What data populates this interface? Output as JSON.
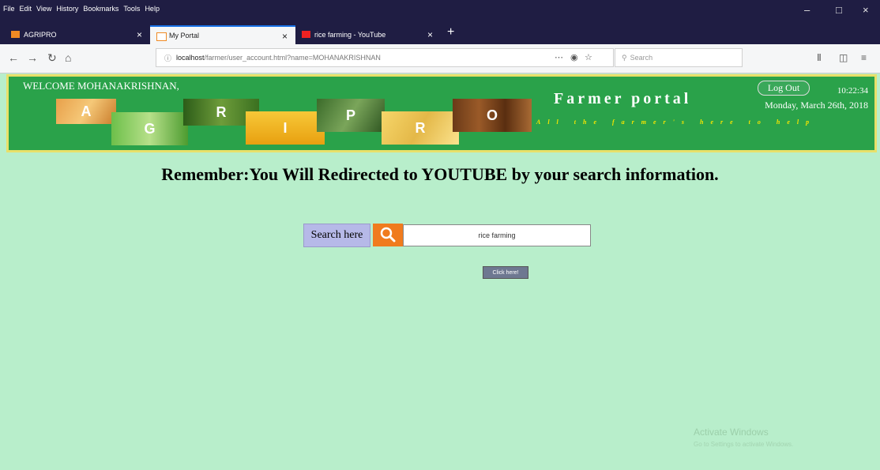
{
  "menubar": {
    "items": [
      "File",
      "Edit",
      "View",
      "History",
      "Bookmarks",
      "Tools",
      "Help"
    ]
  },
  "tabs": [
    {
      "label": "AGRIPRO"
    },
    {
      "label": "My Portal"
    },
    {
      "label": "rice farming - YouTube"
    }
  ],
  "navbar": {
    "url_host": "localhost",
    "url_rest": "/farmer/user_account.html?name=MOHANAKRISHNAN",
    "search_placeholder": "Search"
  },
  "header": {
    "welcome": "WELCOME MOHANAKRISHNAN,",
    "letters": [
      "A",
      "G",
      "R",
      "I",
      "P",
      "R",
      "O"
    ],
    "portal_title": "Farmer portal",
    "tagline": "All the farmer's here to help",
    "logout": "Log Out",
    "time": "10:22:34",
    "date": "Monday, March 26th, 2018"
  },
  "main": {
    "remember": "Remember:You Will Redirected to YOUTUBE by your search information.",
    "search_label": "Search here",
    "search_value": "rice farming",
    "click_button": "Click here!"
  },
  "watermark": {
    "line1": "Activate Windows",
    "line2": "Go to Settings to activate Windows."
  },
  "colors": {
    "page_bg": "#b8eecb",
    "header_bg": "#2aa24a",
    "header_border": "#e8e06a",
    "search_icon_bg": "#f07b1e",
    "tagline": "#f6e600"
  }
}
